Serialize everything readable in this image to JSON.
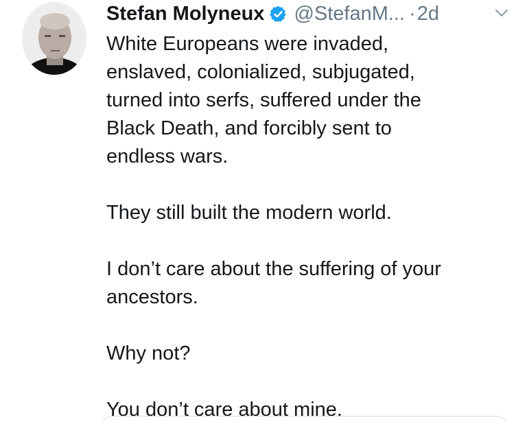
{
  "tweet": {
    "author_name": "Stefan Molyneux",
    "handle": "@StefanM...",
    "separator": "·",
    "time": "2d",
    "paragraphs": [
      {
        "lines": [
          "White Europeans were invaded,",
          "enslaved, colonialized, subjugated,",
          "turned into serfs, suffered under the",
          "Black Death, and forcibly sent to",
          "endless wars."
        ]
      },
      {
        "lines": [
          "They still built the modern world."
        ]
      },
      {
        "lines": [
          "I don’t care about the suffering of your",
          "ancestors."
        ]
      },
      {
        "lines": [
          "Why not?"
        ]
      },
      {
        "lines": [
          "You don’t care about mine."
        ]
      }
    ]
  },
  "icons": {
    "verified": "verified-badge-icon",
    "caret": "chevron-down-icon"
  },
  "colors": {
    "name": "#14171a",
    "secondary_text": "#657786",
    "verified_blue": "#1da1f2"
  }
}
